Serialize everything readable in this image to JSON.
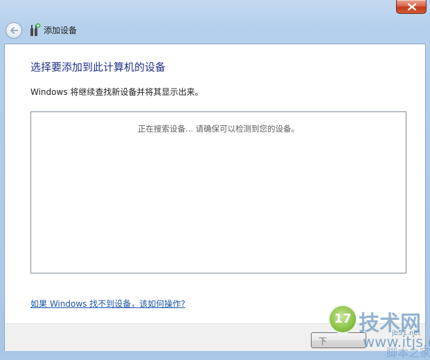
{
  "window": {
    "title": "添加设备",
    "close_icon": "close-icon",
    "back_icon": "back-arrow-icon",
    "device_icon": "add-device-icon"
  },
  "content": {
    "heading": "选择要添加到此计算机的设备",
    "subtext": "Windows 将继续查找新设备并将其显示出来。",
    "device_list": {
      "status_text": "正在搜索设备... 请确保可以检测到您的设备。"
    },
    "help_link": "如果 Windows 找不到设备，该如何操作?"
  },
  "footer": {
    "next_label": "下"
  },
  "watermark": {
    "logo_number": "17",
    "site_name": "技术网",
    "url_1": "jb51.net",
    "url_2": "www.itjs.cn",
    "url_3": "脚本之家"
  },
  "colors": {
    "heading": "#1e3287",
    "link": "#1a55a8",
    "frame": "#a9c6e6"
  }
}
